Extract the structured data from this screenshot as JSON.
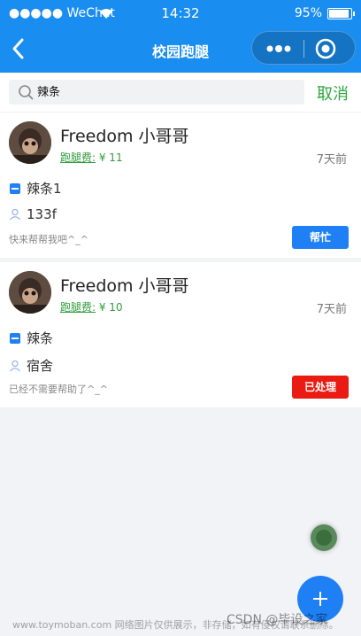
{
  "status_bar": {
    "carrier": "●●●●● WeChat",
    "time": "14:32",
    "battery": "95%",
    "battery_level": 0.95
  },
  "nav": {
    "title": "校园跑腿"
  },
  "search": {
    "value": "辣条",
    "cancel": "取消"
  },
  "posts": [
    {
      "name": "Freedom  小哥哥",
      "fee_label": "跑腿费:",
      "fee_value": " ¥ 11",
      "time": "7天前",
      "item": "辣条1",
      "location": "133f",
      "note": "快来帮帮我吧^_^",
      "button": "帮忙",
      "button_color": "#1f80f5"
    },
    {
      "name": "Freedom  小哥哥",
      "fee_label": "跑腿费:",
      "fee_value": " ¥ 10",
      "time": "7天前",
      "item": "辣条",
      "location": "宿舍",
      "note": "已经不需要帮助了^_^",
      "button": "已处理",
      "button_color": "#ea1b12"
    }
  ],
  "watermark": {
    "left": "www.toymoban.com 网络图片仅供展示，非存储，如有侵权请联系删除。",
    "right": "CSDN @毕设之家"
  },
  "colors": {
    "brand": "#1a8df0",
    "cancel": "#2aa83c",
    "fee": "#2f9c3d"
  }
}
